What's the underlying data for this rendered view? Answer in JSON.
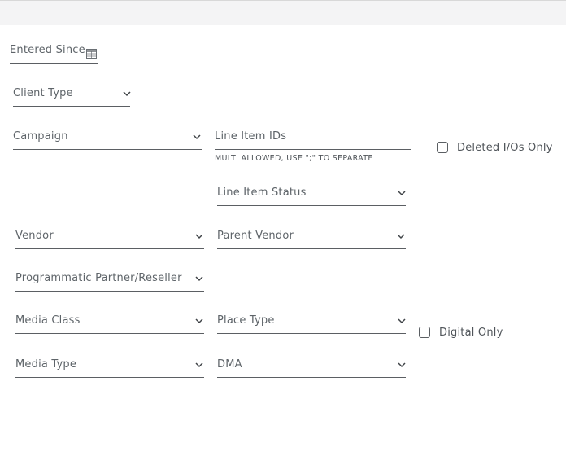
{
  "filters": {
    "entered_since": {
      "label": "Entered Since",
      "icon": "calendar-icon"
    },
    "client_type": {
      "label": "Client Type"
    },
    "campaign": {
      "label": "Campaign"
    },
    "line_item_ids": {
      "label": "Line Item IDs",
      "hint": "MULTI ALLOWED, USE \";\" TO SEPARATE"
    },
    "deleted_ios_only": {
      "label": "Deleted I/Os Only",
      "checked": false
    },
    "line_item_status": {
      "label": "Line Item Status"
    },
    "vendor": {
      "label": "Vendor"
    },
    "parent_vendor": {
      "label": "Parent Vendor"
    },
    "programmatic_partner": {
      "label": "Programmatic Partner/Reseller"
    },
    "media_class": {
      "label": "Media Class"
    },
    "place_type": {
      "label": "Place Type"
    },
    "digital_only": {
      "label": "Digital Only",
      "checked": false
    },
    "media_type": {
      "label": "Media Type"
    },
    "dma": {
      "label": "DMA"
    }
  },
  "icons": {
    "dropdown": "chevron-down-icon"
  }
}
